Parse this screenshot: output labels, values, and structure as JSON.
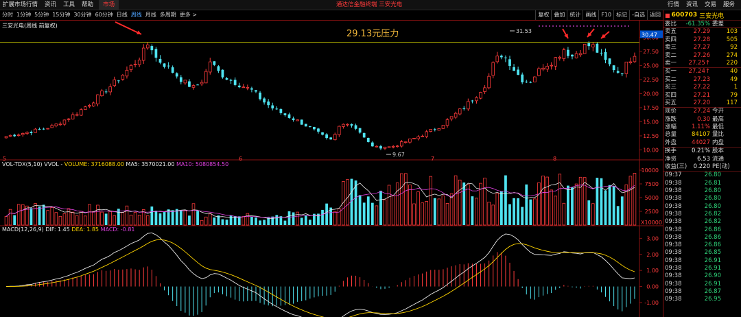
{
  "topbar": {
    "menu": [
      "扩展市场行情",
      "资讯",
      "工具",
      "帮助",
      "市场"
    ],
    "active_menu": 4,
    "title": "通达信金融终端  三安光电",
    "right_buttons": [
      "行情",
      "资讯",
      "交易",
      "服务"
    ]
  },
  "periodbar": {
    "periods": [
      "分时",
      "1分钟",
      "5分钟",
      "15分钟",
      "30分钟",
      "60分钟",
      "日线",
      "周线",
      "月线",
      "多周期",
      "更多 >"
    ],
    "active_period": 7,
    "tools": [
      "复权",
      "叠加",
      "统计",
      "画线",
      "F10",
      "标记",
      "-自选",
      "返回"
    ]
  },
  "kline": {
    "label": "三安光电(周线 前复权)",
    "resistance_label": "29.13元压力",
    "resistance_price": 29.13,
    "high_marker": "31.53",
    "low_marker": "9.67",
    "current_price_tag": "30.47",
    "price_axis": [
      "30.00",
      "27.50",
      "25.00",
      "22.50",
      "20.00",
      "17.50",
      "15.00",
      "12.50",
      "10.00"
    ],
    "price_axis_values": [
      30,
      27.5,
      25,
      22.5,
      20,
      17.5,
      15,
      12.5,
      10
    ],
    "ymin": 8.6,
    "ymax": 31.5,
    "year_markers": [
      "5",
      "6",
      "7",
      "8"
    ],
    "colors": {
      "up": "#ff3b3b",
      "down": "#4fe3f0",
      "resistance": "#b8b800",
      "arrow": "#ff2a2a"
    }
  },
  "vol": {
    "label_name": "VOL-TDX(5,10)",
    "label_vvol": "VVOL -",
    "label_volume": "VOLUME: 3716088.00",
    "label_ma5": "MA5: 3570021.00",
    "label_ma10": "MA10: 5080854.50",
    "axis": [
      "10000",
      "7500",
      "5000",
      "2500"
    ],
    "axis_unit": "X10000",
    "ymax": 10500
  },
  "macd": {
    "label_name": "MACD(12,26,9)",
    "label_dif": "DIF: 1.45",
    "label_dea": "DEA: 1.85",
    "label_macd": "MACD: -0.81",
    "axis": [
      "3.00",
      "2.00",
      "1.00",
      "0.00",
      "-1.00"
    ],
    "axis_values": [
      3,
      2,
      1,
      0,
      -1
    ],
    "ymin": -1.9,
    "ymax": 3.4
  },
  "chart_data": {
    "type": "candlestick",
    "title": "三安光电(周线 前复权)",
    "x_count": 152,
    "resistance": 29.13,
    "anchors_close": [
      [
        0,
        12.4
      ],
      [
        10,
        13.2
      ],
      [
        20,
        14.2
      ],
      [
        30,
        16.5
      ],
      [
        38,
        19.0
      ],
      [
        45,
        21.5
      ],
      [
        50,
        23.5
      ],
      [
        55,
        25.5
      ],
      [
        58,
        27.0
      ],
      [
        61,
        29.2
      ],
      [
        64,
        26.2
      ],
      [
        68,
        25.0
      ],
      [
        72,
        23.5
      ],
      [
        76,
        22.0
      ],
      [
        80,
        21.0
      ],
      [
        84,
        22.5
      ],
      [
        87,
        25.8
      ],
      [
        90,
        24.0
      ],
      [
        95,
        22.5
      ],
      [
        100,
        21.5
      ],
      [
        105,
        20.5
      ],
      [
        110,
        18.5
      ],
      [
        115,
        17.0
      ],
      [
        120,
        16.0
      ],
      [
        125,
        15.0
      ],
      [
        130,
        13.8
      ],
      [
        134,
        12.7
      ],
      [
        138,
        11.5
      ],
      [
        140,
        12.5
      ],
      [
        143,
        15.0
      ],
      [
        147,
        14.5
      ],
      [
        150,
        13.7
      ],
      [
        152,
        12.4
      ],
      [
        155,
        11.0
      ],
      [
        158,
        10.4
      ],
      [
        161,
        10.6
      ],
      [
        164,
        10.5
      ],
      [
        166,
        10.8
      ],
      [
        170,
        11.4
      ],
      [
        175,
        12.2
      ],
      [
        180,
        13.2
      ],
      [
        185,
        14.2
      ],
      [
        190,
        15.8
      ],
      [
        195,
        17.5
      ],
      [
        200,
        19.5
      ],
      [
        205,
        22.0
      ],
      [
        208,
        25.5
      ],
      [
        211,
        27.0
      ],
      [
        214,
        26.0
      ],
      [
        217,
        24.0
      ],
      [
        220,
        22.5
      ],
      [
        223,
        22.0
      ],
      [
        226,
        23.5
      ],
      [
        229,
        25.0
      ],
      [
        232,
        25.5
      ],
      [
        235,
        26.5
      ],
      [
        238,
        28.0
      ],
      [
        241,
        26.5
      ],
      [
        244,
        27.5
      ],
      [
        247,
        28.5
      ],
      [
        250,
        28.5
      ],
      [
        253,
        27.0
      ],
      [
        256,
        25.5
      ],
      [
        259,
        24.5
      ],
      [
        262,
        23.5
      ],
      [
        265,
        25.5
      ],
      [
        268,
        27.2
      ]
    ],
    "volume_axis_max": 10500,
    "series": [
      {
        "name": "VOLUME",
        "values_desc": "weekly volume x10000"
      },
      {
        "name": "DIF"
      },
      {
        "name": "DEA"
      },
      {
        "name": "MACD"
      }
    ]
  },
  "quote": {
    "code": "600703",
    "name": "三安光电",
    "webi_label": "委比",
    "webi_value": "-61.35%",
    "wecha_label": "委差",
    "sells": [
      {
        "label": "卖五",
        "price": "27.29",
        "vol": "103"
      },
      {
        "label": "卖四",
        "price": "27.28",
        "vol": "505"
      },
      {
        "label": "卖三",
        "price": "27.27",
        "vol": "92"
      },
      {
        "label": "卖二",
        "price": "27.26",
        "vol": "274"
      },
      {
        "label": "卖一",
        "price": "27.25↑",
        "vol": "220"
      }
    ],
    "buys": [
      {
        "label": "买一",
        "price": "27.24↑",
        "vol": "40"
      },
      {
        "label": "买二",
        "price": "27.23",
        "vol": "49"
      },
      {
        "label": "买三",
        "price": "27.22",
        "vol": "1"
      },
      {
        "label": "买四",
        "price": "27.21",
        "vol": "79"
      },
      {
        "label": "买五",
        "price": "27.20",
        "vol": "117"
      }
    ],
    "stats": [
      {
        "l": "现价",
        "v": "27.24",
        "l2": "今开",
        "cls": "red"
      },
      {
        "l": "涨跌",
        "v": "0.30",
        "l2": "最高",
        "cls": "red"
      },
      {
        "l": "涨幅",
        "v": "1.11%",
        "l2": "最低",
        "cls": "red"
      },
      {
        "l": "总量",
        "v": "84107",
        "l2": "量比",
        "cls": "yellow"
      },
      {
        "l": "外盘",
        "v": "44027",
        "l2": "内盘",
        "cls": "red"
      }
    ],
    "stats2": [
      {
        "l": "换手",
        "v": "0.21%",
        "l2": "股本",
        "cls": "white"
      },
      {
        "l": "净资",
        "v": "6.53",
        "l2": "流通",
        "cls": "white"
      },
      {
        "l": "收益(三)",
        "v": "0.220",
        "l2": "PE(动)",
        "cls": "white"
      }
    ],
    "ticks": [
      {
        "t": "09:37",
        "p": "26.80"
      },
      {
        "t": "09:38",
        "p": "26.81"
      },
      {
        "t": "09:38",
        "p": "26.80"
      },
      {
        "t": "09:38",
        "p": "26.80"
      },
      {
        "t": "09:38",
        "p": "26.80"
      },
      {
        "t": "09:38",
        "p": "26.82"
      },
      {
        "t": "09:38",
        "p": "26.82"
      },
      {
        "t": "09:38",
        "p": "26.86"
      },
      {
        "t": "09:38",
        "p": "26.86"
      },
      {
        "t": "09:38",
        "p": "26.86"
      },
      {
        "t": "09:38",
        "p": "26.85"
      },
      {
        "t": "09:38",
        "p": "26.91"
      },
      {
        "t": "09:38",
        "p": "26.91"
      },
      {
        "t": "09:38",
        "p": "26.90"
      },
      {
        "t": "09:38",
        "p": "26.91"
      },
      {
        "t": "09:38",
        "p": "26.87"
      },
      {
        "t": "09:38",
        "p": "26.95"
      }
    ]
  }
}
